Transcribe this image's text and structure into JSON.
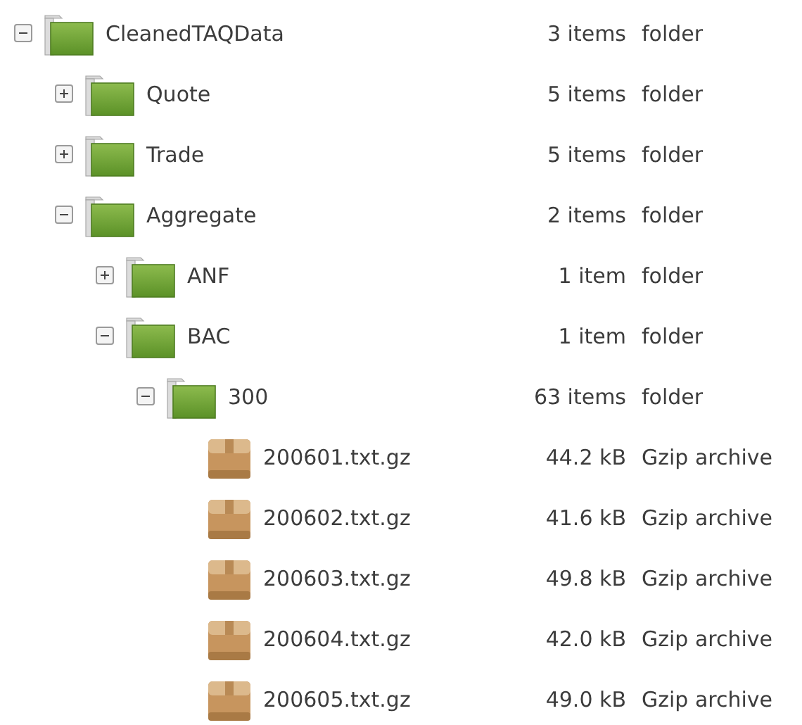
{
  "tree": [
    {
      "name": "CleanedTAQData",
      "size": "3 items",
      "type": "folder",
      "kind": "folder",
      "expanded": true,
      "children": [
        {
          "name": "Quote",
          "size": "5 items",
          "type": "folder",
          "kind": "folder",
          "expanded": false
        },
        {
          "name": "Trade",
          "size": "5 items",
          "type": "folder",
          "kind": "folder",
          "expanded": false
        },
        {
          "name": "Aggregate",
          "size": "2 items",
          "type": "folder",
          "kind": "folder",
          "expanded": true,
          "children": [
            {
              "name": "ANF",
              "size": "1 item",
              "type": "folder",
              "kind": "folder",
              "expanded": false
            },
            {
              "name": "BAC",
              "size": "1 item",
              "type": "folder",
              "kind": "folder",
              "expanded": true,
              "children": [
                {
                  "name": "300",
                  "size": "63 items",
                  "type": "folder",
                  "kind": "folder",
                  "expanded": true,
                  "children": [
                    {
                      "name": "200601.txt.gz",
                      "size": "44.2 kB",
                      "type": "Gzip archive",
                      "kind": "archive"
                    },
                    {
                      "name": "200602.txt.gz",
                      "size": "41.6 kB",
                      "type": "Gzip archive",
                      "kind": "archive"
                    },
                    {
                      "name": "200603.txt.gz",
                      "size": "49.8 kB",
                      "type": "Gzip archive",
                      "kind": "archive"
                    },
                    {
                      "name": "200604.txt.gz",
                      "size": "42.0 kB",
                      "type": "Gzip archive",
                      "kind": "archive"
                    },
                    {
                      "name": "200605.txt.gz",
                      "size": "49.0 kB",
                      "type": "Gzip archive",
                      "kind": "archive"
                    }
                  ]
                }
              ]
            }
          ]
        }
      ]
    }
  ]
}
